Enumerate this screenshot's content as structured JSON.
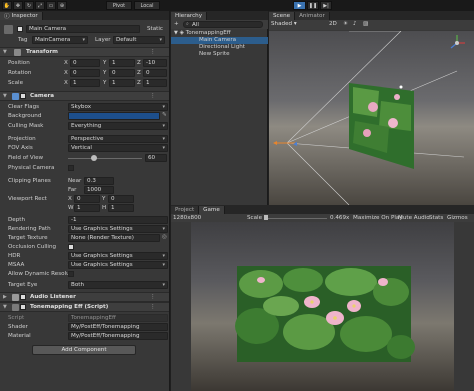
{
  "toolbar": {
    "pivot": "Pivot",
    "local": "Local"
  },
  "inspector": {
    "tab": "Inspector",
    "object_name": "Main Camera",
    "static_label": "Static",
    "tag_label": "Tag",
    "tag": "MainCamera",
    "layer_label": "Layer",
    "layer": "Default",
    "transform": {
      "title": "Transform",
      "position": {
        "label": "Position",
        "x": "0",
        "y": "1",
        "z": "-10"
      },
      "rotation": {
        "label": "Rotation",
        "x": "0",
        "y": "0",
        "z": "0"
      },
      "scale": {
        "label": "Scale",
        "x": "1",
        "y": "1",
        "z": "1"
      }
    },
    "camera": {
      "title": "Camera",
      "clear_flags": {
        "label": "Clear Flags",
        "value": "Skybox"
      },
      "background": {
        "label": "Background"
      },
      "culling_mask": {
        "label": "Culling Mask",
        "value": "Everything"
      },
      "projection": {
        "label": "Projection",
        "value": "Perspective"
      },
      "fov_axis": {
        "label": "FOV Axis",
        "value": "Vertical"
      },
      "fov": {
        "label": "Field of View",
        "value": "60"
      },
      "physical": {
        "label": "Physical Camera"
      },
      "clipping": {
        "label": "Clipping Planes",
        "near_label": "Near",
        "near": "0.3",
        "far_label": "Far",
        "far": "1000"
      },
      "viewport": {
        "label": "Viewport Rect",
        "x": "0",
        "y": "0",
        "w": "1",
        "h": "1"
      },
      "depth": {
        "label": "Depth",
        "value": "-1"
      },
      "rendering_path": {
        "label": "Rendering Path",
        "value": "Use Graphics Settings"
      },
      "target_texture": {
        "label": "Target Texture",
        "value": "None (Render Texture)"
      },
      "occlusion": {
        "label": "Occlusion Culling"
      },
      "hdr": {
        "label": "HDR",
        "value": "Use Graphics Settings"
      },
      "msaa": {
        "label": "MSAA",
        "value": "Use Graphics Settings"
      },
      "dynres": {
        "label": "Allow Dynamic Resoluti"
      },
      "target_eye": {
        "label": "Target Eye",
        "value": "Both"
      }
    },
    "audio_listener": {
      "title": "Audio Listener"
    },
    "tonemapping": {
      "title": "Tonemapping Eff (Script)",
      "script_label": "Script",
      "script": "TonemappingEff",
      "shader_label": "Shader",
      "shader": "My/PostEff/Tonemapping",
      "material_label": "Material",
      "material": "My/PostEff/Tonemapping"
    },
    "add_component": "Add Component"
  },
  "hierarchy": {
    "tab": "Hierarchy",
    "create": "+",
    "search": "All",
    "scene": "TonemappingEff",
    "items": [
      "Main Camera",
      "Directional Light",
      "New Sprite"
    ]
  },
  "scene": {
    "tab1": "Scene",
    "tab2": "Animator",
    "shading": "Shaded",
    "mode2d": "2D"
  },
  "game": {
    "tab1": "Project",
    "tab2": "Game",
    "resolution": "1280x800",
    "scale_label": "Scale",
    "scale_value": "0.469x",
    "maximize": "Maximize On Play",
    "mute": "Mute Audio",
    "stats": "Stats",
    "gizmos": "Gizmos"
  },
  "colors": {
    "play": "#3a72b0",
    "background_swatch": "#1d4f8c",
    "camera_icon": "#5a8fd0",
    "accent_blue": "#3a72b0"
  }
}
